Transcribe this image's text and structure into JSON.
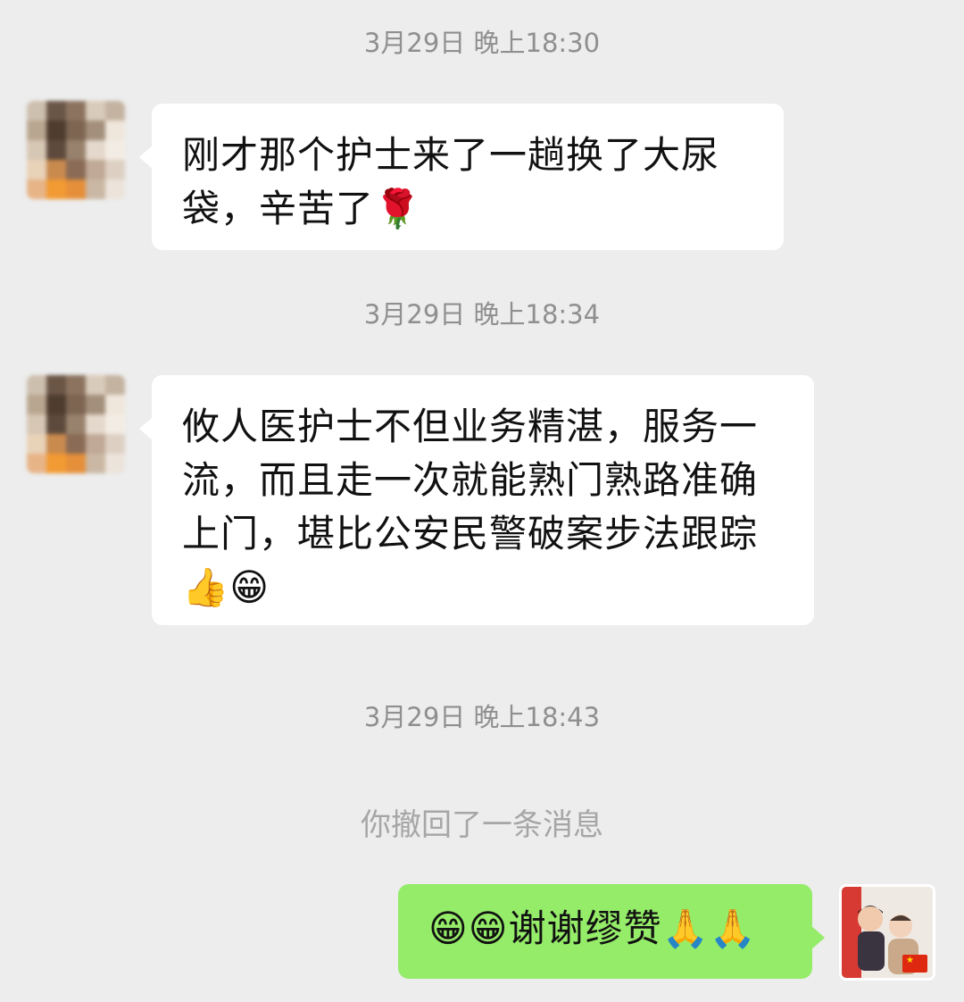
{
  "messages": [
    {
      "timestamp": "3月29日 晚上18:30",
      "text_lines": [
        "刚才那个护士来了一趟换了大尿",
        "袋，辛苦了🌹"
      ]
    },
    {
      "timestamp": "3月29日 晚上18:34",
      "text_lines": [
        "攸人医护士不但业务精湛，服务一",
        "流，而且走一次就能熟门熟路准确",
        "上门，堪比公安民警破案步法跟踪",
        "👍😁"
      ]
    },
    {
      "timestamp": "3月29日 晚上18:43",
      "recall_notice": "你撤回了一条消息",
      "sent_text": "😁😁谢谢缪赞🙏🙏"
    }
  ],
  "colors": {
    "background": "#ededed",
    "received_bubble": "#ffffff",
    "sent_bubble": "#95ec69",
    "timestamp_text": "#8f8f8f"
  },
  "icons": {
    "flag": "china-flag-icon"
  }
}
